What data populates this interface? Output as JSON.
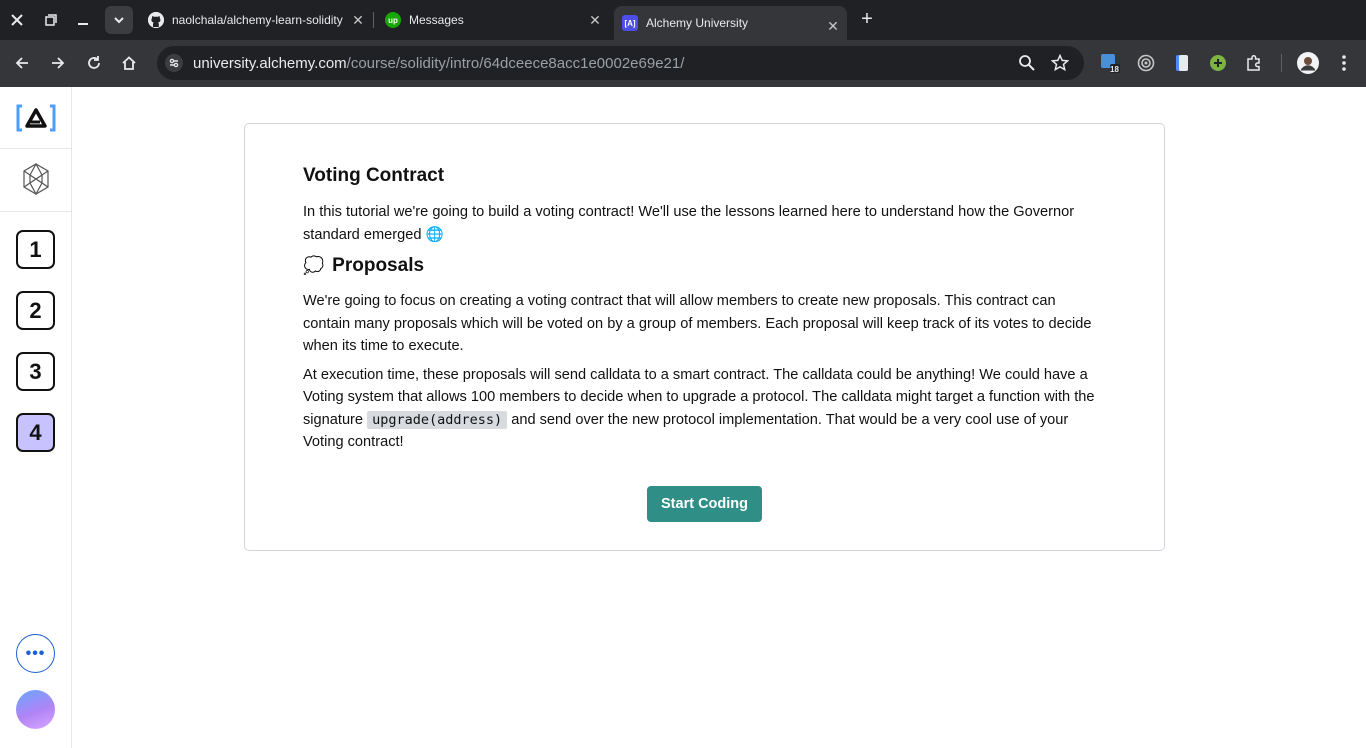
{
  "browser": {
    "tabs": [
      {
        "title": "naolchala/alchemy-learn-solidity",
        "active": false,
        "icon": "github-icon"
      },
      {
        "title": "Messages",
        "active": false,
        "icon": "upwork-icon"
      },
      {
        "title": "Alchemy University",
        "active": true,
        "icon": "alchemy-icon"
      }
    ],
    "url_host": "university.alchemy.com",
    "url_path": "/course/solidity/intro/64dceece8acc1e0002e69e21/",
    "extension_badge": "18"
  },
  "sidebar": {
    "steps": [
      "1",
      "2",
      "3",
      "4"
    ],
    "active_step": "4",
    "more_label": "•••"
  },
  "lesson": {
    "title": "Voting Contract",
    "intro_text": "In this tutorial we're going to build a voting contract! We'll use the lessons learned here to understand how the Governor standard emerged",
    "intro_emoji": "🌐",
    "section_emoji": "💭",
    "section_title": "Proposals",
    "paragraph_1": "We're going to focus on creating a voting contract that will allow members to create new proposals. This contract can contain many proposals which will be voted on by a group of members. Each proposal will keep track of its votes to decide when its time to execute.",
    "paragraph_2_before": "At execution time, these proposals will send calldata to a smart contract. The calldata could be anything! We could have a Voting system that allows 100 members to decide when to upgrade a protocol. The calldata might target a function with the signature",
    "paragraph_2_code": "upgrade(address)",
    "paragraph_2_after": "and send over the new protocol implementation. That would be a very cool use of your Voting contract!",
    "cta_label": "Start Coding"
  },
  "colors": {
    "accent": "#2f8f87",
    "active_step": "#c8c2ff",
    "link_blue": "#1d5fd6"
  }
}
